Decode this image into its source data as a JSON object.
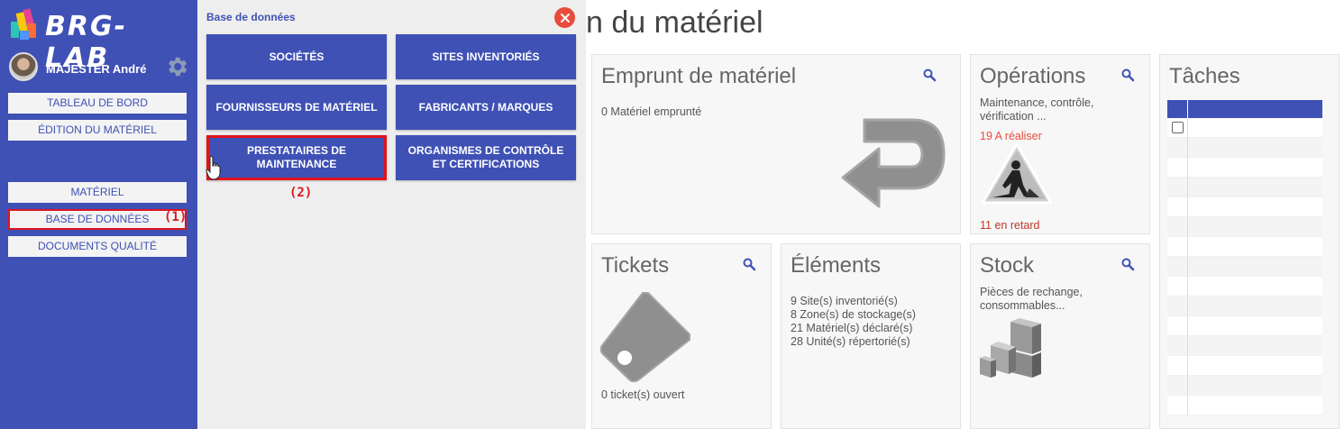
{
  "app": {
    "name": "BRG-LAB"
  },
  "user": {
    "name": "MAJESTER André"
  },
  "sidebar": {
    "items": [
      {
        "label": "TABLEAU DE BORD"
      },
      {
        "label": "ÉDITION DU MATÉRIEL"
      },
      {
        "label": "MATÉRIEL"
      },
      {
        "label": "BASE DE DONNÉES"
      },
      {
        "label": "DOCUMENTS QUALITÉ"
      }
    ]
  },
  "annotations": {
    "step1": "(1)",
    "step2": "(2)"
  },
  "database_panel": {
    "title": "Base de données",
    "buttons": [
      {
        "label": "SOCIÉTÉS"
      },
      {
        "label": "SITES INVENTORIÉS"
      },
      {
        "label": "FOURNISSEURS DE MATÉRIEL"
      },
      {
        "label": "FABRICANTS / MARQUES"
      },
      {
        "label": "PRESTATAIRES DE MAINTENANCE"
      },
      {
        "label": "ORGANISMES DE CONTRÔLE ET CERTIFICATIONS"
      }
    ]
  },
  "main": {
    "page_title": "n du matériel",
    "cards": {
      "emprunt": {
        "title": "Emprunt de matériel",
        "text": "0 Matériel emprunté"
      },
      "operations": {
        "title": "Opérations",
        "text": "Maintenance, contrôle, vérification ...",
        "to_do": "19 A réaliser",
        "late": "11 en retard"
      },
      "taches": {
        "title": "Tâches"
      },
      "tickets": {
        "title": "Tickets",
        "text": "0 ticket(s) ouvert"
      },
      "elements": {
        "title": "Éléments",
        "lines": [
          "9 Site(s) inventorié(s)",
          "8 Zone(s) de stockage(s)",
          "21 Matériel(s) déclaré(s)",
          "28 Unité(s) répertorié(s)"
        ]
      },
      "stock": {
        "title": "Stock",
        "text": "Pièces de rechange, consommables..."
      }
    }
  },
  "colors": {
    "primary": "#3f51b5",
    "highlight": "#e0141e",
    "close": "#e74c3c"
  },
  "icons": [
    "gear-icon",
    "close-icon",
    "search-icon",
    "return-arrow-icon",
    "worker-warning-icon",
    "tag-icon",
    "boxes-icon",
    "hand-cursor-icon"
  ]
}
